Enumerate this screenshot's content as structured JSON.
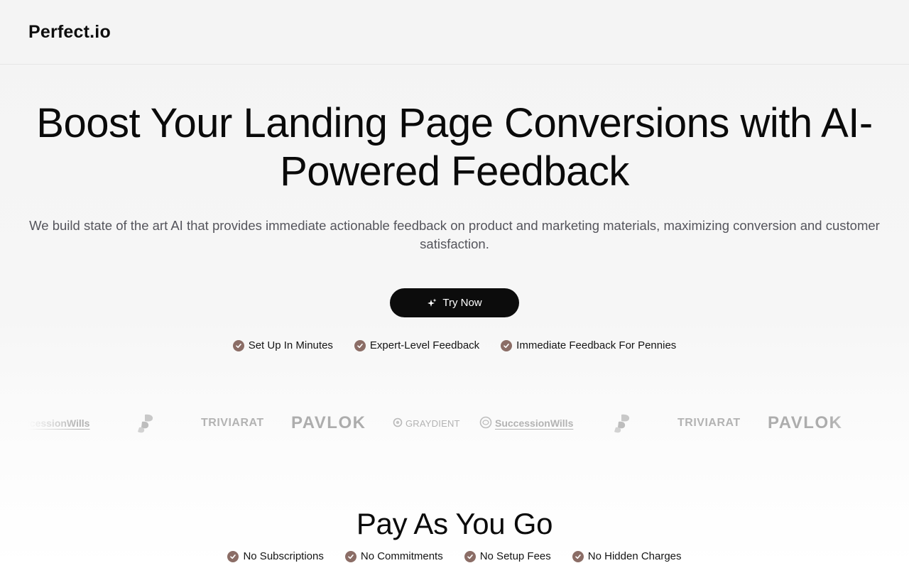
{
  "header": {
    "logo": "Perfect.io"
  },
  "hero": {
    "title": "Boost Your Landing Page Conversions with AI-Powered Feedback",
    "subtitle": "We build state of the art AI that provides immediate actionable feedback on product and marketing materials, maximizing conversion and customer satisfaction.",
    "cta_label": "Try Now",
    "cta_icon": "sparkle-icon",
    "features": [
      "Set Up In Minutes",
      "Expert-Level Feedback",
      "Immediate Feedback For Pennies"
    ]
  },
  "logos": {
    "items": [
      {
        "name": "SuccessionWills",
        "visible_text": "ccessionWills"
      },
      {
        "name": "abstract-shape-logo",
        "visible_text": ""
      },
      {
        "name": "TriviaRat",
        "visible_text": "TRIVIARAT"
      },
      {
        "name": "Pavlok",
        "visible_text": "PAVLOK"
      },
      {
        "name": "Graydient",
        "visible_text": "GRAYDIENT"
      },
      {
        "name": "SuccessionWills",
        "visible_text": "SuccessionWills"
      },
      {
        "name": "abstract-shape-logo",
        "visible_text": ""
      },
      {
        "name": "TriviaRat",
        "visible_text": "TRIVIARAT"
      },
      {
        "name": "Pavlok",
        "visible_text": "PAVLOK"
      }
    ]
  },
  "pricing": {
    "title": "Pay As You Go",
    "features": [
      "No Subscriptions",
      "No Commitments",
      "No Setup Fees",
      "No Hidden Charges"
    ]
  },
  "colors": {
    "check_badge": "#8b6d66",
    "cta_background": "#0c0c0c",
    "subtitle_text": "#55555c",
    "logo_gray": "#b3b3b3"
  }
}
